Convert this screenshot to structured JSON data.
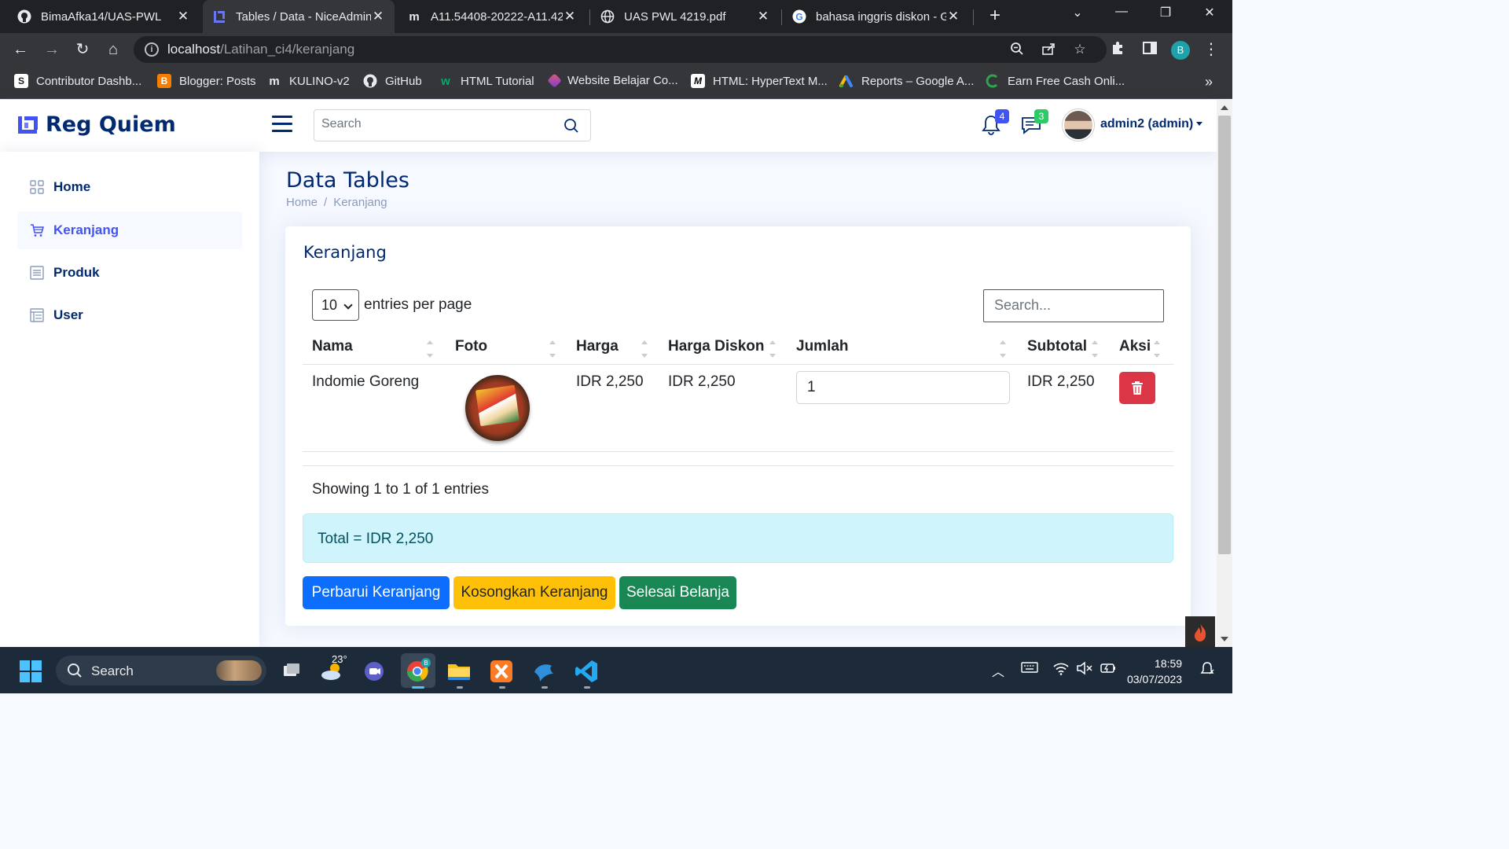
{
  "browser": {
    "tabs": [
      {
        "title": "BimaAfka14/UAS-PWL",
        "favicon": "github-icon"
      },
      {
        "title": "Tables / Data - NiceAdmin",
        "favicon": "niceadmin-icon",
        "active": true
      },
      {
        "title": "A11.54408-20222-A11.42",
        "favicon": "moodle-icon"
      },
      {
        "title": "UAS PWL 4219.pdf",
        "favicon": "globe-icon"
      },
      {
        "title": "bahasa inggris diskon - G",
        "favicon": "google-icon"
      }
    ],
    "url_host": "localhost",
    "url_path": "/Latihan_ci4/keranjang",
    "profile_initial": "B",
    "bookmarks": [
      {
        "label": "Contributor Dashb...",
        "icon": "shutterstock-icon"
      },
      {
        "label": "Blogger: Posts",
        "icon": "blogger-icon"
      },
      {
        "label": "KULINO-v2",
        "icon": "moodle-icon"
      },
      {
        "label": "GitHub",
        "icon": "github-icon"
      },
      {
        "label": "HTML Tutorial",
        "icon": "w3schools-icon"
      },
      {
        "label": "Website Belajar Co...",
        "icon": "codepolitan-icon"
      },
      {
        "label": "HTML: HyperText M...",
        "icon": "mdn-icon"
      },
      {
        "label": "Reports – Google A...",
        "icon": "google-ads-icon"
      },
      {
        "label": "Earn Free Cash Onli...",
        "icon": "cash-icon"
      }
    ],
    "more_bookmarks": "»"
  },
  "header": {
    "logo_text": "Reg Quiem",
    "search_placeholder": "Search",
    "notifications_count": "4",
    "messages_count": "3",
    "user_name": "admin2 (admin)",
    "colors": {
      "brand": "#012970",
      "accent": "#4154f1",
      "notif_badge": "#4154f1",
      "msg_badge": "#2eca6a"
    }
  },
  "sidebar": {
    "items": [
      {
        "label": "Home",
        "icon": "grid-icon"
      },
      {
        "label": "Keranjang",
        "icon": "cart-icon",
        "active": true
      },
      {
        "label": "Produk",
        "icon": "list-icon"
      },
      {
        "label": "User",
        "icon": "table-icon"
      }
    ]
  },
  "main": {
    "page_title": "Data Tables",
    "breadcrumb": [
      "Home",
      "Keranjang"
    ],
    "card_title": "Keranjang",
    "per_page_value": "10",
    "per_page_label": "entries per page",
    "search_placeholder": "Search...",
    "columns": [
      "Nama",
      "Foto",
      "Harga",
      "Harga Diskon",
      "Jumlah",
      "Subtotal",
      "Aksi"
    ],
    "rows": [
      {
        "nama": "Indomie Goreng",
        "foto": "indomie-goreng-image",
        "harga": "IDR 2,250",
        "harga_diskon": "IDR 2,250",
        "jumlah": "1",
        "subtotal": "IDR 2,250",
        "aksi": "trash-icon"
      }
    ],
    "showing": "Showing 1 to 1 of 1 entries",
    "total": "Total = IDR 2,250",
    "buttons": {
      "update": "Perbarui Keranjang",
      "clear": "Kosongkan Keranjang",
      "checkout": "Selesai Belanja"
    }
  },
  "taskbar": {
    "search_label": "Search",
    "weather_temp": "23°",
    "time": "18:59",
    "date": "03/07/2023"
  }
}
